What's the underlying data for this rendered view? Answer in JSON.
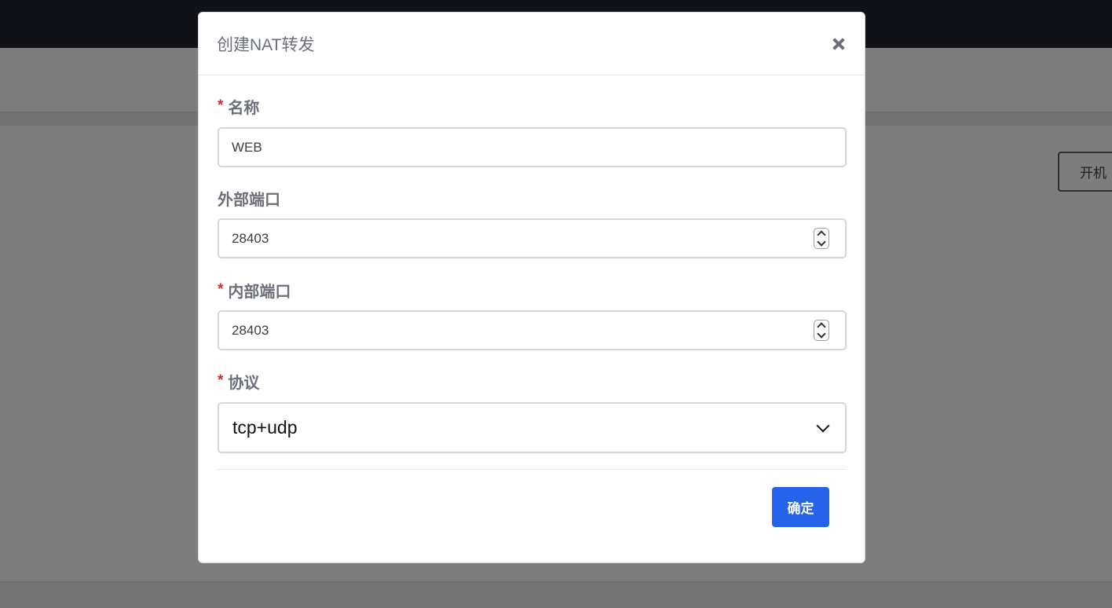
{
  "background": {
    "power_button_label": "开机"
  },
  "modal": {
    "title": "创建NAT转发",
    "close_icon": "close-icon",
    "fields": {
      "name": {
        "label": "名称",
        "required": true,
        "value": "WEB"
      },
      "external_port": {
        "label": "外部端口",
        "required": false,
        "value": "28403"
      },
      "internal_port": {
        "label": "内部端口",
        "required": true,
        "value": "28403"
      },
      "protocol": {
        "label": "协议",
        "required": true,
        "value": "tcp+udp"
      }
    },
    "required_mark": "*",
    "confirm_label": "确定"
  },
  "colors": {
    "accent": "#2563eb",
    "required": "#dc2626",
    "label": "#6b6f78"
  }
}
